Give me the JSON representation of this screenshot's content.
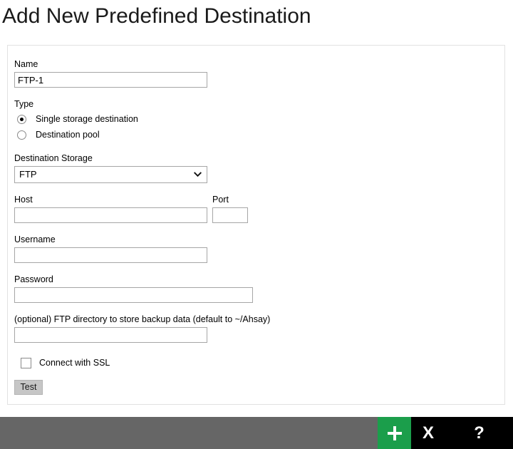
{
  "page": {
    "title": "Add New Predefined Destination"
  },
  "form": {
    "name": {
      "label": "Name",
      "value": "FTP-1",
      "placeholder": ""
    },
    "type": {
      "label": "Type",
      "options": [
        {
          "label": "Single storage destination",
          "selected": true
        },
        {
          "label": "Destination pool",
          "selected": false
        }
      ]
    },
    "destination_storage": {
      "label": "Destination Storage",
      "selected": "FTP",
      "chevron_icon": "chevron-down-icon"
    },
    "host": {
      "label": "Host",
      "value": "",
      "placeholder": ""
    },
    "port": {
      "label": "Port",
      "value": "",
      "placeholder": ""
    },
    "username": {
      "label": "Username",
      "value": "",
      "placeholder": ""
    },
    "password": {
      "label": "Password",
      "value": "",
      "placeholder": ""
    },
    "directory": {
      "label": "(optional) FTP directory to store backup data (default to ~/Ahsay)",
      "value": "",
      "placeholder": ""
    },
    "ssl": {
      "label": "Connect with SSL",
      "checked": false
    },
    "test_button": {
      "label": "Test"
    }
  },
  "bottom_bar": {
    "background": "#666666",
    "buttons": [
      {
        "icon": "plus-icon",
        "label": "+",
        "color": "#1b9e4b"
      },
      {
        "icon": "close-x-icon",
        "label": "X",
        "color": "#000000"
      },
      {
        "icon": "help-question-icon",
        "label": "?",
        "color": "#000000"
      }
    ]
  }
}
